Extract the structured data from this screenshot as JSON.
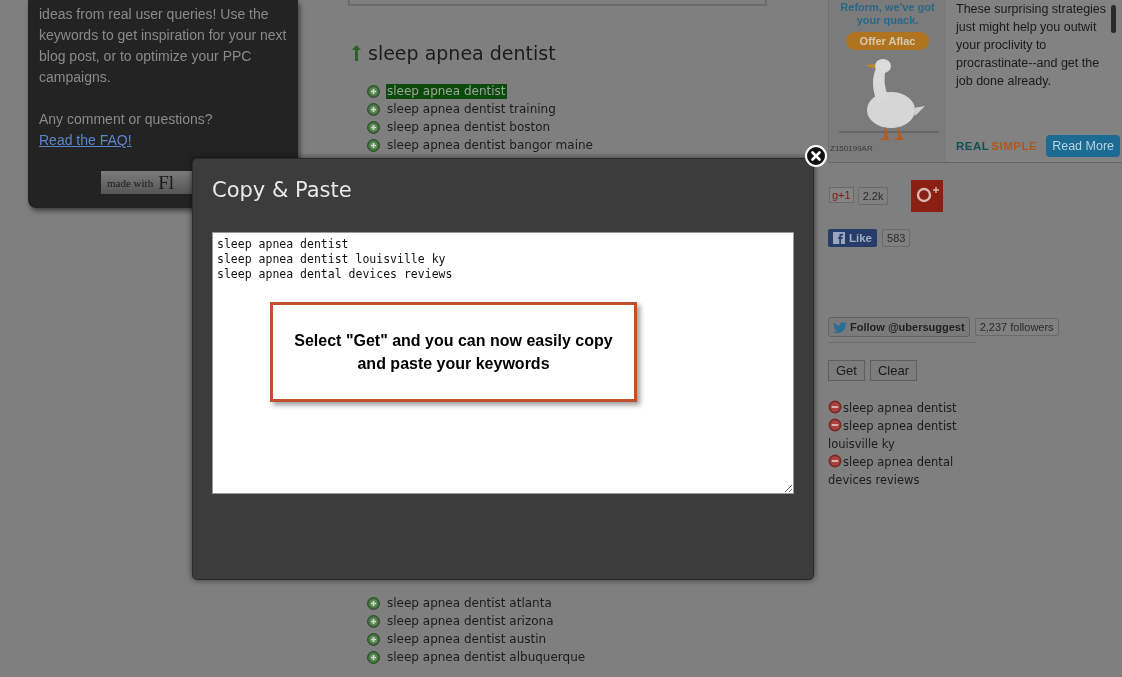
{
  "sidebar": {
    "intro": "ideas from real user queries! Use the keywords to get inspiration for your next blog post, or to optimize your PPC campaigns.",
    "question": "Any comment or questions?",
    "faq_link": "Read the FAQ!",
    "badge_prefix": "made with",
    "badge_brand": "Fl"
  },
  "results": {
    "heading": "sleep apnea dentist",
    "keywords_above": [
      {
        "text": "sleep apnea dentist",
        "selected": true
      },
      {
        "text": "sleep apnea dentist training",
        "selected": false
      },
      {
        "text": "sleep apnea dentist boston",
        "selected": false
      },
      {
        "text": "sleep apnea dentist bangor maine",
        "selected": false
      }
    ],
    "keywords_below": [
      {
        "text": "sleep apnea dentist atlanta",
        "selected": false
      },
      {
        "text": "sleep apnea dentist arizona",
        "selected": false
      },
      {
        "text": "sleep apnea dentist austin",
        "selected": false
      },
      {
        "text": "sleep apnea dentist albuquerque",
        "selected": false
      }
    ]
  },
  "ad": {
    "headline": "Reform, we've got your quack.",
    "offer_button": "Offer Aflac",
    "code": "Z150199AR",
    "story": "These surprising strategies just might help you outwit your proclivity to procrastinate--and get the job done already.",
    "brand": [
      {
        "text": "REAL",
        "color": "#0f4f57"
      },
      {
        "text": "SIMPLE",
        "color": "#b1561d"
      }
    ],
    "read_more": "Read More"
  },
  "social": {
    "gplus_label": "g+1",
    "gplus_count": "2.2k",
    "facebook_label": "Like",
    "facebook_count": "583",
    "twitter_label": "Follow @ubersuggest",
    "twitter_count": "2,237 followers"
  },
  "actions": [
    "Get",
    "Clear"
  ],
  "selected_keywords": [
    "sleep apnea dentist",
    "sleep apnea dentist louisville ky",
    "sleep apnea dental devices reviews"
  ],
  "modal": {
    "title": "Copy & Paste",
    "lines": [
      "sleep apnea dentist",
      "sleep apnea dentist louisville ky",
      "sleep apnea dental devices reviews"
    ],
    "callout": "Select \"Get\" and you can now easily copy and paste your keywords"
  }
}
